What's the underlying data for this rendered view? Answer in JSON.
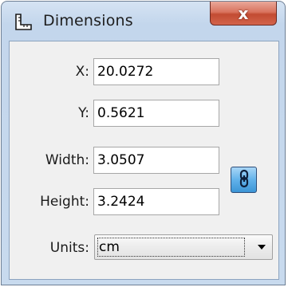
{
  "window": {
    "title": "Dimensions",
    "close_label": "x"
  },
  "form": {
    "x_label": "X:",
    "x_value": "20.0272",
    "y_label": "Y:",
    "y_value": "0.5621",
    "width_label": "Width:",
    "width_value": "3.0507",
    "height_label": "Height:",
    "height_value": "3.2424",
    "units_label": "Units:",
    "units_value": "cm"
  },
  "icons": {
    "app": "ruler-corner-icon",
    "link": "chain-link-icon",
    "dropdown": "chevron-down-icon"
  },
  "colors": {
    "client_bg": "#f0f0f0",
    "close_red": "#c24b32",
    "link_blue": "#62b2ea"
  }
}
